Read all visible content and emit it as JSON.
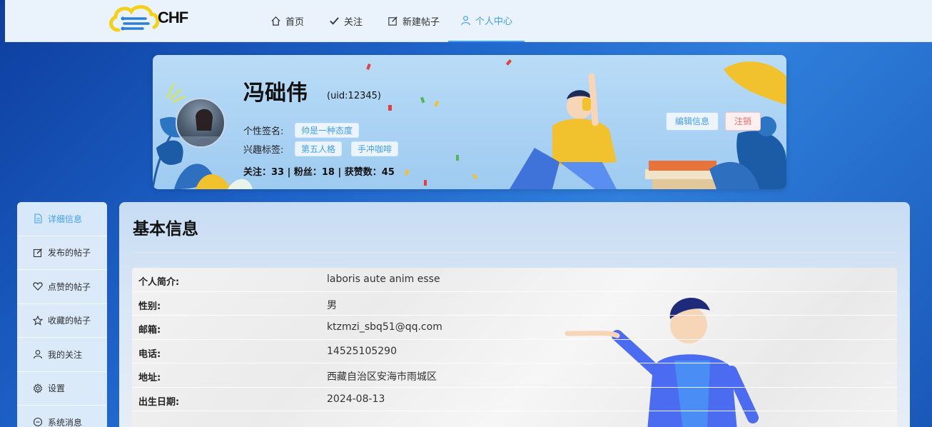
{
  "app": {
    "logo_text": "CHF"
  },
  "nav": [
    {
      "label": "首页",
      "icon": "home-icon"
    },
    {
      "label": "关注",
      "icon": "check-icon"
    },
    {
      "label": "新建帖子",
      "icon": "edit-icon"
    },
    {
      "label": "个人中心",
      "icon": "user-icon",
      "active": true
    }
  ],
  "profile": {
    "name": "冯础伟",
    "uid": "(uid:12345)",
    "signature_label": "个性签名:",
    "signature": "帅是一种态度",
    "interest_label": "兴趣标签:",
    "interests": [
      "第五人格",
      "手冲咖啡"
    ],
    "stats": "关注：33 | 粉丝：18 | 获赞数：45",
    "edit_button": "编辑信息",
    "logout_button": "注销"
  },
  "sidebar": {
    "items": [
      {
        "label": "详细信息",
        "icon": "document-icon",
        "active": true
      },
      {
        "label": "发布的帖子",
        "icon": "edit-icon"
      },
      {
        "label": "点赞的帖子",
        "icon": "heart-icon"
      },
      {
        "label": "收藏的帖子",
        "icon": "star-icon"
      },
      {
        "label": "我的关注",
        "icon": "user-icon"
      },
      {
        "label": "设置",
        "icon": "gear-icon"
      },
      {
        "label": "系统消息",
        "icon": "message-icon"
      }
    ]
  },
  "main": {
    "title": "基本信息",
    "rows": [
      {
        "label": "个人简介:",
        "value": "laboris aute anim esse"
      },
      {
        "label": "性别:",
        "value": "男"
      },
      {
        "label": "邮箱:",
        "value": "ktzmzi_sbq51@qq.com"
      },
      {
        "label": "电话:",
        "value": "14525105290"
      },
      {
        "label": "地址:",
        "value": "西藏自治区安海市雨城区"
      },
      {
        "label": "出生日期:",
        "value": "2024-08-13"
      }
    ]
  },
  "colors": {
    "accent": "#409eff",
    "danger": "#f56c6c",
    "nav_bg": "#eaf3fb",
    "page_bg": "#1e63c9"
  }
}
